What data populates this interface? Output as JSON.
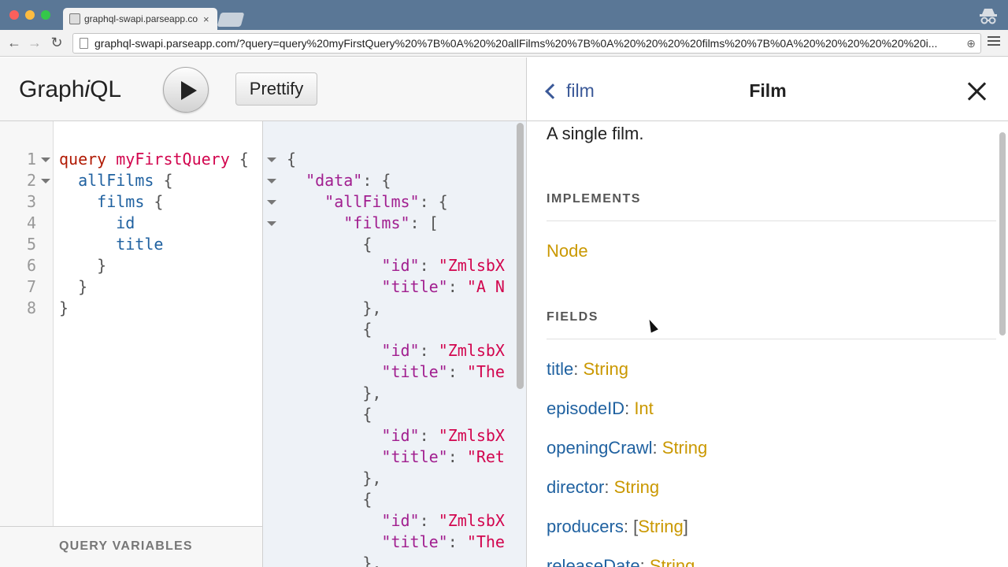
{
  "browser": {
    "tab_title": "graphql-swapi.parseapp.com",
    "tab_close": "×",
    "url": "graphql-swapi.parseapp.com/?query=query%20myFirstQuery%20%7B%0A%20%20allFilms%20%7B%0A%20%20%20%20films%20%7B%0A%20%20%20%20%20%20i...",
    "back": "←",
    "forward": "→",
    "reload": "↻",
    "zoom": "⊕"
  },
  "graphiql": {
    "logo_pre": "Graph",
    "logo_i": "i",
    "logo_post": "QL",
    "prettify_label": "Prettify",
    "query_variables_label": "QUERY VARIABLES",
    "query_lines": [
      {
        "num": "1",
        "fold": true,
        "tokens": [
          [
            "kw",
            "query"
          ],
          [
            "punc",
            " "
          ],
          [
            "def",
            "myFirstQuery"
          ],
          [
            "punc",
            " {"
          ]
        ]
      },
      {
        "num": "2",
        "fold": true,
        "tokens": [
          [
            "punc",
            "  "
          ],
          [
            "prop",
            "allFilms"
          ],
          [
            "punc",
            " {"
          ]
        ]
      },
      {
        "num": "3",
        "fold": false,
        "tokens": [
          [
            "punc",
            "    "
          ],
          [
            "prop",
            "films"
          ],
          [
            "punc",
            " {"
          ]
        ]
      },
      {
        "num": "4",
        "fold": false,
        "tokens": [
          [
            "punc",
            "      "
          ],
          [
            "prop",
            "id"
          ]
        ]
      },
      {
        "num": "5",
        "fold": false,
        "tokens": [
          [
            "punc",
            "      "
          ],
          [
            "prop",
            "title"
          ]
        ]
      },
      {
        "num": "6",
        "fold": false,
        "tokens": [
          [
            "punc",
            "    }"
          ]
        ]
      },
      {
        "num": "7",
        "fold": false,
        "tokens": [
          [
            "punc",
            "  }"
          ]
        ]
      },
      {
        "num": "8",
        "fold": false,
        "tokens": [
          [
            "punc",
            "}"
          ]
        ]
      }
    ],
    "result_lines": [
      {
        "fold": true,
        "tokens": [
          [
            "punc",
            "{"
          ]
        ]
      },
      {
        "fold": true,
        "tokens": [
          [
            "punc",
            "  "
          ],
          [
            "key",
            "\"data\""
          ],
          [
            "punc",
            ": {"
          ]
        ]
      },
      {
        "fold": true,
        "tokens": [
          [
            "punc",
            "    "
          ],
          [
            "key",
            "\"allFilms\""
          ],
          [
            "punc",
            ": {"
          ]
        ]
      },
      {
        "fold": true,
        "tokens": [
          [
            "punc",
            "      "
          ],
          [
            "key",
            "\"films\""
          ],
          [
            "punc",
            ": ["
          ]
        ]
      },
      {
        "fold": false,
        "tokens": [
          [
            "punc",
            "        {"
          ]
        ]
      },
      {
        "fold": false,
        "tokens": [
          [
            "punc",
            "          "
          ],
          [
            "key",
            "\"id\""
          ],
          [
            "punc",
            ": "
          ],
          [
            "str",
            "\"ZmlsbX"
          ]
        ]
      },
      {
        "fold": false,
        "tokens": [
          [
            "punc",
            "          "
          ],
          [
            "key",
            "\"title\""
          ],
          [
            "punc",
            ": "
          ],
          [
            "str",
            "\"A N"
          ]
        ]
      },
      {
        "fold": false,
        "tokens": [
          [
            "punc",
            "        },"
          ]
        ]
      },
      {
        "fold": false,
        "tokens": [
          [
            "punc",
            "        {"
          ]
        ]
      },
      {
        "fold": false,
        "tokens": [
          [
            "punc",
            "          "
          ],
          [
            "key",
            "\"id\""
          ],
          [
            "punc",
            ": "
          ],
          [
            "str",
            "\"ZmlsbX"
          ]
        ]
      },
      {
        "fold": false,
        "tokens": [
          [
            "punc",
            "          "
          ],
          [
            "key",
            "\"title\""
          ],
          [
            "punc",
            ": "
          ],
          [
            "str",
            "\"The"
          ]
        ]
      },
      {
        "fold": false,
        "tokens": [
          [
            "punc",
            "        },"
          ]
        ]
      },
      {
        "fold": false,
        "tokens": [
          [
            "punc",
            "        {"
          ]
        ]
      },
      {
        "fold": false,
        "tokens": [
          [
            "punc",
            "          "
          ],
          [
            "key",
            "\"id\""
          ],
          [
            "punc",
            ": "
          ],
          [
            "str",
            "\"ZmlsbX"
          ]
        ]
      },
      {
        "fold": false,
        "tokens": [
          [
            "punc",
            "          "
          ],
          [
            "key",
            "\"title\""
          ],
          [
            "punc",
            ": "
          ],
          [
            "str",
            "\"Ret"
          ]
        ]
      },
      {
        "fold": false,
        "tokens": [
          [
            "punc",
            "        },"
          ]
        ]
      },
      {
        "fold": false,
        "tokens": [
          [
            "punc",
            "        {"
          ]
        ]
      },
      {
        "fold": false,
        "tokens": [
          [
            "punc",
            "          "
          ],
          [
            "key",
            "\"id\""
          ],
          [
            "punc",
            ": "
          ],
          [
            "str",
            "\"ZmlsbX"
          ]
        ]
      },
      {
        "fold": false,
        "tokens": [
          [
            "punc",
            "          "
          ],
          [
            "key",
            "\"title\""
          ],
          [
            "punc",
            ": "
          ],
          [
            "str",
            "\"The"
          ]
        ]
      },
      {
        "fold": false,
        "tokens": [
          [
            "punc",
            "        },"
          ]
        ]
      }
    ]
  },
  "doc_explorer": {
    "back_label": "film",
    "title": "Film",
    "description": "A single film.",
    "implements_label": "IMPLEMENTS",
    "implements": [
      "Node"
    ],
    "fields_label": "FIELDS",
    "fields": [
      {
        "name": "title",
        "type": "String",
        "list": false
      },
      {
        "name": "episodeID",
        "type": "Int",
        "list": false
      },
      {
        "name": "openingCrawl",
        "type": "String",
        "list": false
      },
      {
        "name": "director",
        "type": "String",
        "list": false
      },
      {
        "name": "producers",
        "type": "String",
        "list": true
      },
      {
        "name": "releaseDate",
        "type": "String",
        "list": false
      }
    ]
  }
}
